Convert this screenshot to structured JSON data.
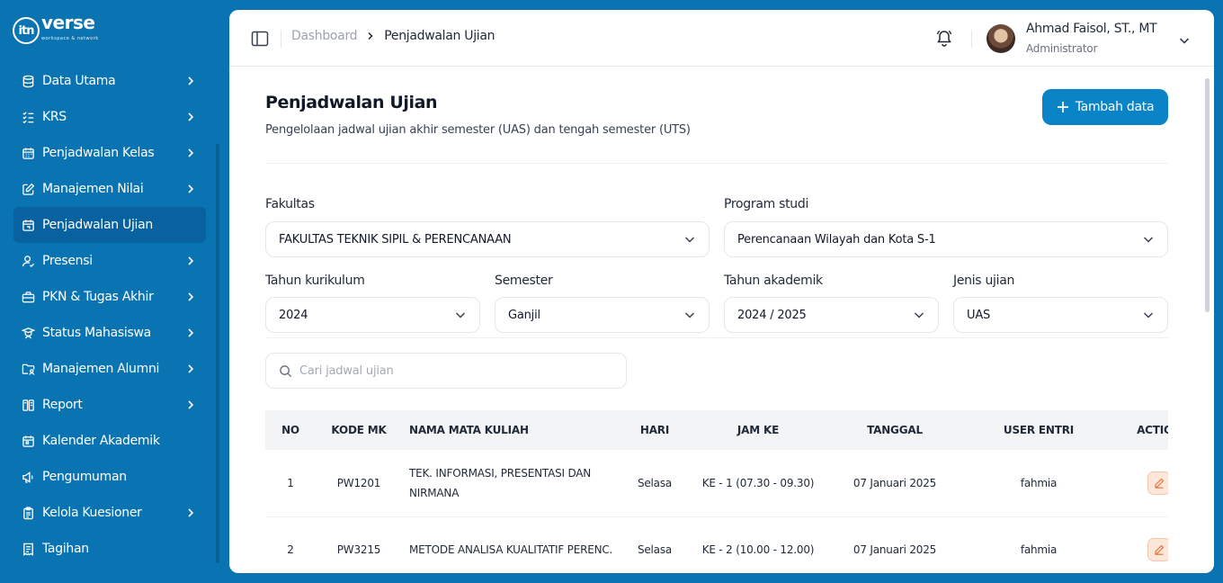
{
  "brand": {
    "name": "verse",
    "mark": "itn",
    "tagline": "workspace & network"
  },
  "sidebar": {
    "items": [
      {
        "label": "Data Utama",
        "icon": "database-icon",
        "chevron": true,
        "active": false
      },
      {
        "label": "KRS",
        "icon": "list-check-icon",
        "chevron": true,
        "active": false
      },
      {
        "label": "Penjadwalan Kelas",
        "icon": "calendar-grid-icon",
        "chevron": true,
        "active": false
      },
      {
        "label": "Manajemen Nilai",
        "icon": "edit-square-icon",
        "chevron": true,
        "active": false
      },
      {
        "label": "Penjadwalan Ujian",
        "icon": "calendar-exam-icon",
        "chevron": false,
        "active": true
      },
      {
        "label": "Presensi",
        "icon": "user-check-icon",
        "chevron": true,
        "active": false
      },
      {
        "label": "PKN & Tugas Akhir",
        "icon": "briefcase-icon",
        "chevron": true,
        "active": false
      },
      {
        "label": "Status Mahasiswa",
        "icon": "student-icon",
        "chevron": true,
        "active": false
      },
      {
        "label": "Manajemen Alumni",
        "icon": "folder-user-icon",
        "chevron": true,
        "active": false
      },
      {
        "label": "Report",
        "icon": "report-icon",
        "chevron": true,
        "active": false
      },
      {
        "label": "Kalender Akademik",
        "icon": "calendar-icon",
        "chevron": false,
        "active": false
      },
      {
        "label": "Pengumuman",
        "icon": "megaphone-icon",
        "chevron": false,
        "active": false
      },
      {
        "label": "Kelola Kuesioner",
        "icon": "clipboard-icon",
        "chevron": true,
        "active": false
      },
      {
        "label": "Tagihan",
        "icon": "invoice-icon",
        "chevron": false,
        "active": false
      }
    ]
  },
  "topbar": {
    "breadcrumb_root": "Dashboard",
    "breadcrumb_current": "Penjadwalan Ujian",
    "user_name": "Ahmad Faisol, ST., MT",
    "user_role": "Administrator"
  },
  "page": {
    "title": "Penjadwalan Ujian",
    "subtitle": "Pengelolaan jadwal ujian akhir semester (UAS) dan tengah semester (UTS)",
    "add_button": "Tambah data"
  },
  "filters": {
    "fakultas": {
      "label": "Fakultas",
      "value": "FAKULTAS TEKNIK SIPIL & PERENCANAAN"
    },
    "prodi": {
      "label": "Program studi",
      "value": "Perencanaan Wilayah dan Kota S-1"
    },
    "kurikulum": {
      "label": "Tahun kurikulum",
      "value": "2024"
    },
    "semester": {
      "label": "Semester",
      "value": "Ganjil"
    },
    "akademik": {
      "label": "Tahun akademik",
      "value": "2024 / 2025"
    },
    "jenis": {
      "label": "Jenis ujian",
      "value": "UAS"
    }
  },
  "search": {
    "placeholder": "Cari jadwal ujian"
  },
  "table": {
    "headers": [
      "NO",
      "KODE MK",
      "NAMA MATA KULIAH",
      "HARI",
      "JAM KE",
      "TANGGAL",
      "USER ENTRI",
      "ACTION"
    ],
    "rows": [
      {
        "no": "1",
        "kode": "PW1201",
        "nama": "TEK. INFORMASI, PRESENTASI DAN NIRMANA",
        "hari": "Selasa",
        "jam": "KE - 1 (07.30 - 09.30)",
        "tanggal": "07 Januari 2025",
        "user": "fahmia"
      },
      {
        "no": "2",
        "kode": "PW3215",
        "nama": "METODE ANALISA KUALITATIF PERENC.",
        "hari": "Selasa",
        "jam": "KE - 2 (10.00 - 12.00)",
        "tanggal": "07 Januari 2025",
        "user": "fahmia"
      }
    ]
  },
  "colors": {
    "sidebar_bg": "#0a74b3",
    "active_item": "#0962a0",
    "primary_button": "#0a84c6",
    "edit_button": "#fde6da"
  }
}
